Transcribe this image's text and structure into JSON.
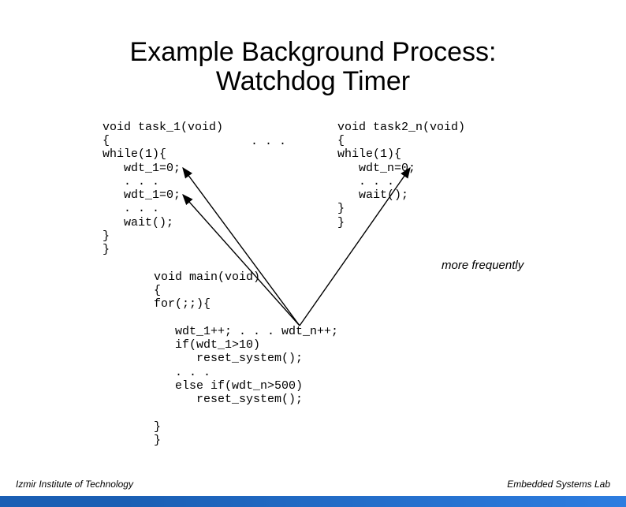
{
  "title_line1": "Example Background Process:",
  "title_line2": "Watchdog Timer",
  "code_left": "void task_1(void)\n{\nwhile(1){\n   wdt_1=0;\n   . . .\n   wdt_1=0;\n   . . .\n   wait();\n}\n}",
  "ellipsis_mid": ". . .",
  "code_right": "void task2_n(void)\n{\nwhile(1){\n   wdt_n=0;\n   . . .\n   wait();\n}\n}",
  "code_main": "void main(void)\n{\nfor(;;){\n\n   wdt_1++; . . . wdt_n++;\n   if(wdt_1>10)\n      reset_system();\n   . . .\n   else if(wdt_n>500)\n      reset_system();\n\n}\n}",
  "note": "more frequently",
  "footer_left": "Izmir Institute of Technology",
  "footer_right": "Embedded Systems Lab"
}
